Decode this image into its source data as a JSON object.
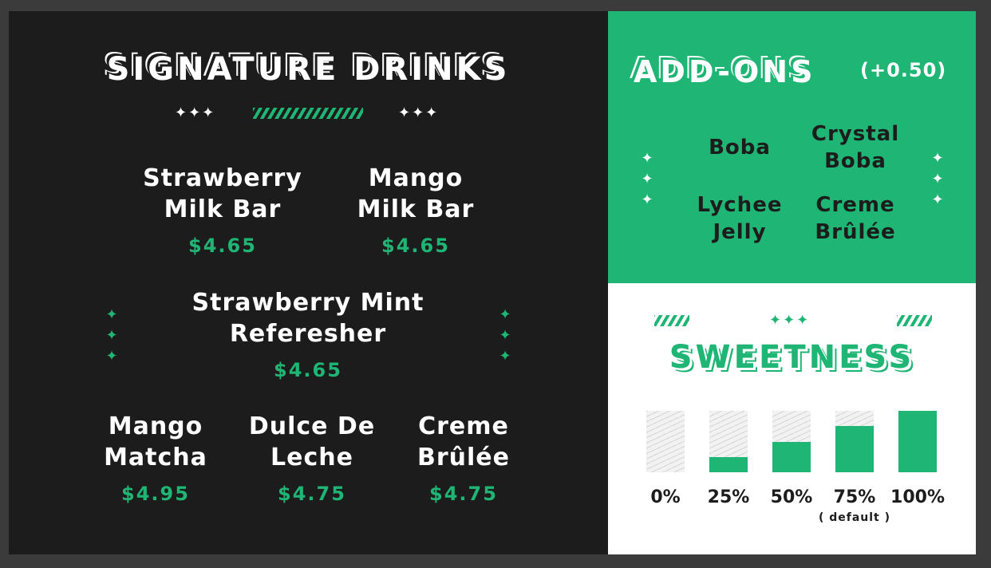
{
  "colors": {
    "accent": "#1fb574",
    "dark": "#1c1c1c",
    "white": "#ffffff"
  },
  "left": {
    "title": "SIGNATURE DRINKS",
    "deco_stars": "✦✦✦",
    "drinks": [
      {
        "name": "Strawberry\nMilk Bar",
        "price": "$4.65"
      },
      {
        "name": "Mango\nMilk Bar",
        "price": "$4.65"
      },
      {
        "name": "Strawberry Mint\nReferesher",
        "price": "$4.65"
      },
      {
        "name": "Mango\nMatcha",
        "price": "$4.95"
      },
      {
        "name": "Dulce De\nLeche",
        "price": "$4.75"
      },
      {
        "name": "Creme\nBrûlée",
        "price": "$4.75"
      }
    ]
  },
  "addons": {
    "title": "ADD-ONS",
    "price": "(+0.50)",
    "items": [
      {
        "name": "Boba"
      },
      {
        "name": "Crystal\nBoba"
      },
      {
        "name": "Lychee\nJelly"
      },
      {
        "name": "Creme\nBrûlée"
      }
    ]
  },
  "sweetness": {
    "title": "SWEETNESS",
    "levels": [
      {
        "label": "0%",
        "fill": 0
      },
      {
        "label": "25%",
        "fill": 25
      },
      {
        "label": "50%",
        "fill": 50
      },
      {
        "label": "75%",
        "fill": 75
      },
      {
        "label": "100%",
        "fill": 100
      }
    ],
    "default_note": "( default )"
  }
}
